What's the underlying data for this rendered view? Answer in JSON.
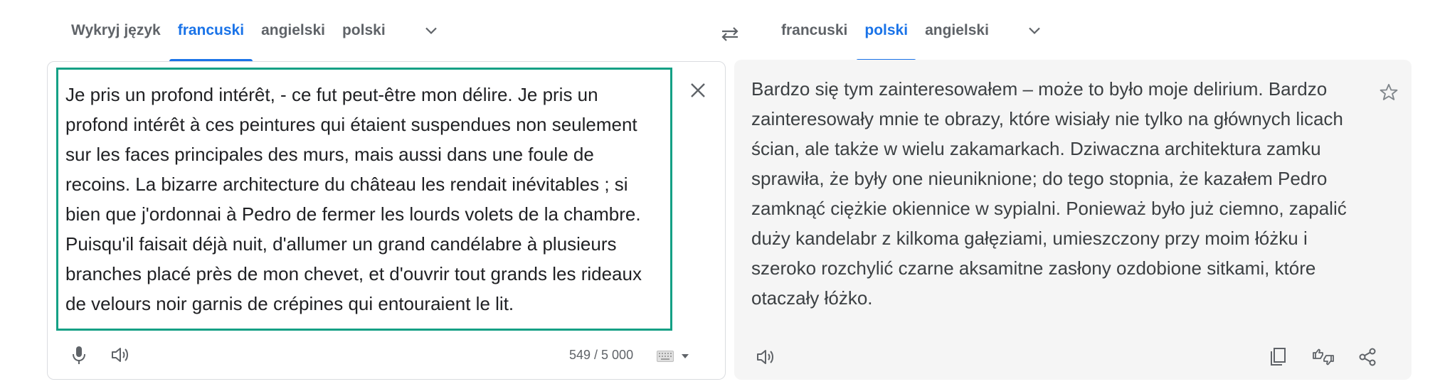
{
  "source_languages": {
    "tabs": [
      "Wykryj język",
      "francuski",
      "angielski",
      "polski"
    ],
    "active_index": 1,
    "more_icon": "chevron-down-icon"
  },
  "target_languages": {
    "tabs": [
      "francuski",
      "polski",
      "angielski"
    ],
    "active_index": 1,
    "more_icon": "chevron-down-icon"
  },
  "swap_icon": "swap-languages-icon",
  "source": {
    "text": "Je pris un profond intérêt, - ce fut peut-être mon délire. Je pris un profond intérêt à ces peintures qui étaient suspendues non seulement sur les faces principales des murs, mais aussi dans une foule de recoins. La bizarre architecture du château les rendait inévitables ; si bien que j'ordonnai à Pedro de fermer les lourds volets de la chambre. Puisqu'il faisait déjà nuit, d'allumer un grand candélabre à plusieurs branches placé près de mon chevet, et d'ouvrir tout grands les rideaux de velours noir garnis de crépines qui entouraient le lit.",
    "char_count": "549 / 5 000"
  },
  "target": {
    "text": "Bardzo się tym zainteresowałem – może to było moje delirium. Bardzo zainteresowały mnie te obrazy, które wisiały nie tylko na głównych licach ścian, ale także w wielu zakamarkach. Dziwaczna architektura zamku sprawiła, że były one nieuniknione; do tego stopnia, że kazałem Pedro zamknąć ciężkie okiennice w sypialni. Ponieważ było już ciemno, zapalić duży kandelabr z kilkoma gałęziami, umieszczony przy moim łóżku i szeroko rozchylić czarne aksamitne zasłony ozdobione sitkami, które otaczały łóżko."
  },
  "colors": {
    "accent": "#1a73e8",
    "highlight_border": "#14a085",
    "icon": "#5f6368",
    "target_bg": "#f5f5f5"
  }
}
